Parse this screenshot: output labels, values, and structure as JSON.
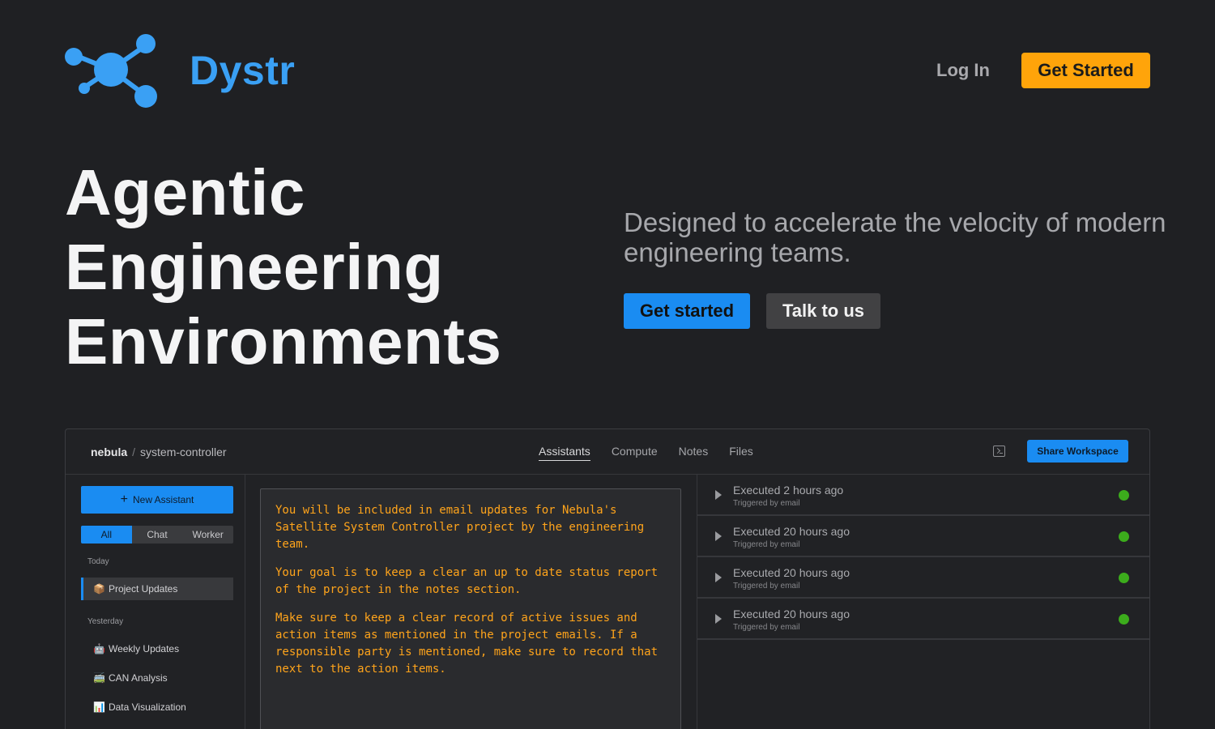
{
  "brand": {
    "name": "Dystr",
    "accent": "#3aa0f4"
  },
  "nav": {
    "login_label": "Log In",
    "get_started_label": "Get Started"
  },
  "hero": {
    "title_lines": [
      "Agentic",
      "Engineering",
      "Environments"
    ],
    "subtitle": "Designed to accelerate the velocity of modern engineering teams.",
    "primary_label": "Get started",
    "secondary_label": "Talk to us"
  },
  "app": {
    "breadcrumb": {
      "workspace": "nebula",
      "separator": "/",
      "project": "system-controller"
    },
    "tabs": [
      {
        "label": "Assistants",
        "active": true
      },
      {
        "label": "Compute"
      },
      {
        "label": "Notes"
      },
      {
        "label": "Files"
      }
    ],
    "share_label": "Share Workspace",
    "sidebar": {
      "new_assistant_label": "New Assistant",
      "filters": [
        "All",
        "Chat",
        "Worker"
      ],
      "groups": [
        {
          "label": "Today",
          "items": [
            {
              "emoji": "📦",
              "label": "Project Updates",
              "active": true
            }
          ]
        },
        {
          "label": "Yesterday",
          "items": [
            {
              "emoji": "🤖",
              "label": "Weekly Updates"
            },
            {
              "emoji": "🚎",
              "label": "CAN Analysis"
            },
            {
              "emoji": "📊",
              "label": "Data Visualization"
            }
          ]
        }
      ]
    },
    "editor": {
      "paragraphs": [
        "You will be included in email updates for Nebula's\nSatellite System Controller project by the engineering\nteam.",
        "Your goal is to keep a clear an up to date status report\nof the project in the notes section.",
        "Make sure to keep a clear record of active issues and\naction items as mentioned in the project emails. If a\nresponsible party is mentioned, make sure to record that\nnext to the action items."
      ]
    },
    "executions": [
      {
        "title": "Executed 2 hours ago",
        "trigger": "Triggered by email",
        "status": "success"
      },
      {
        "title": "Executed 20 hours ago",
        "trigger": "Triggered by email",
        "status": "success"
      },
      {
        "title": "Executed 20 hours ago",
        "trigger": "Triggered by email",
        "status": "success"
      },
      {
        "title": "Executed 20 hours ago",
        "trigger": "Triggered by email",
        "status": "success"
      }
    ]
  }
}
